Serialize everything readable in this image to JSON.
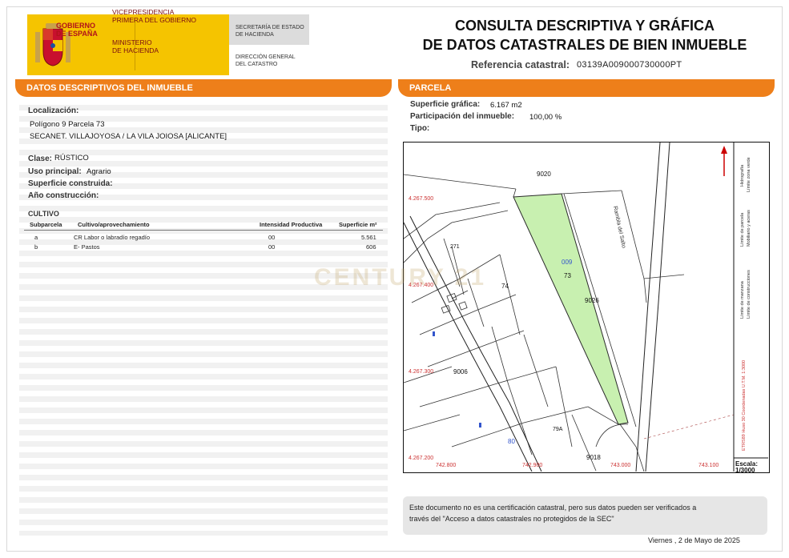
{
  "header": {
    "gov_line1": "GOBIERNO",
    "gov_line2": "DE ESPAÑA",
    "vp_line1": "VICEPRESIDENCIA",
    "vp_line2": "PRIMERA DEL GOBIERNO",
    "min_line1": "MINISTERIO",
    "min_line2": "DE HACIENDA",
    "sec_line1": "SECRETARÍA DE ESTADO",
    "sec_line2": "DE HACIENDA",
    "dir_line1": "DIRECCIÓN GENERAL",
    "dir_line2": "DEL CATASTRO",
    "title_line1": "CONSULTA DESCRIPTIVA Y GRÁFICA",
    "title_line2": "DE DATOS CATASTRALES DE BIEN INMUEBLE",
    "ref_label": "Referencia catastral:",
    "ref_value": "03139A009000730000PT"
  },
  "descriptivos": {
    "bar_title": "DATOS DESCRIPTIVOS DEL INMUEBLE",
    "localizacion_label": "Localización:",
    "localizacion_line1": "Polígono 9 Parcela 73",
    "localizacion_line2": "SECANET. VILLAJOYOSA / LA VILA JOIOSA [ALICANTE]",
    "clase_label": "Clase:",
    "clase_value": "RÚSTICO",
    "uso_label": "Uso principal:",
    "uso_value": "Agrario",
    "superficie_label": "Superficie construida:",
    "anio_label": "Año construcción:"
  },
  "cultivo": {
    "title": "CULTIVO",
    "headers": [
      "Subparcela",
      "Cultivo/aprovechamiento",
      "Intensidad Productiva",
      "Superficie m²"
    ],
    "rows": [
      {
        "subparcela": "a",
        "cultivo": "CR Labor o labradío regadío",
        "intensidad": "00",
        "superficie": "5.561"
      },
      {
        "subparcela": "b",
        "cultivo": "E- Pastos",
        "intensidad": "00",
        "superficie": "606"
      }
    ]
  },
  "parcela": {
    "bar_title": "PARCELA",
    "superficie_label": "Superficie gráfica:",
    "superficie_value": "6.167 m2",
    "participacion_label": "Participación del inmueble:",
    "participacion_value": "100,00 %",
    "tipo_label": "Tipo:"
  },
  "map": {
    "labels": {
      "p9020": "9020",
      "p74": "74",
      "p73": "73",
      "p009": "009",
      "p9026": "9026",
      "p9006": "9006",
      "p9018": "9018",
      "p80": "80",
      "p79a": "79A",
      "p271": "271",
      "road": "Rambla del Salto"
    },
    "coords": {
      "y1": "4.267.500",
      "y2": "4.267.400",
      "y3": "4.267.300",
      "y4": "4.267.200",
      "x1": "742.800",
      "x2": "742.900",
      "x3": "743.000",
      "x4": "743.100"
    },
    "legend": [
      "Límite de manzana",
      "Límite de construcciones",
      "Límite de parcela",
      "Mobiliario y aceras",
      "Hidrografía",
      "Límite zona verde"
    ],
    "projection": "ETRS89  Huso 30  Coordenadas U.T.M.  1:3000",
    "scale_label": "Escala:",
    "scale_value": "1/3000",
    "highlight_color": "#c8f0b0"
  },
  "footer": {
    "note_line1": "Este documento no es una certificación catastral, pero sus datos pueden ser verificados a",
    "note_line2": "través del \"Acceso a datos catastrales no protegidos de la SEC\"",
    "date": "Viernes , 2 de Mayo de 2025"
  },
  "watermark": "CENTURY 21"
}
